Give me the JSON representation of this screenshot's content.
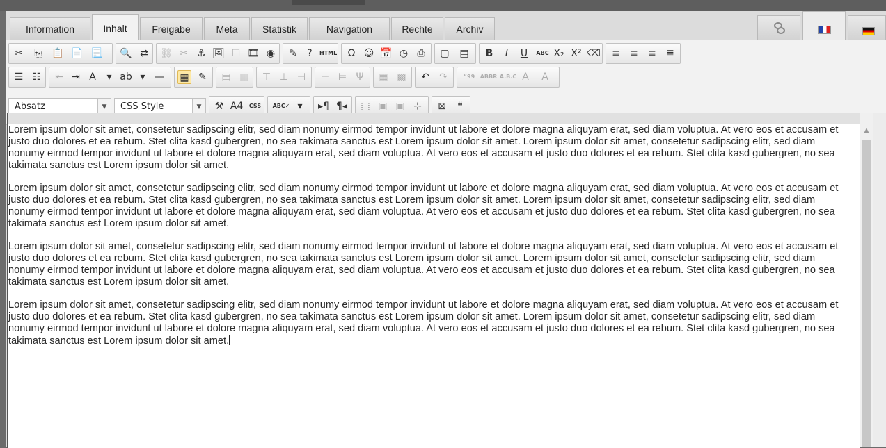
{
  "tabs": [
    {
      "label": "Information",
      "active": false
    },
    {
      "label": "Inhalt",
      "active": true
    },
    {
      "label": "Freigabe",
      "active": false
    },
    {
      "label": "Meta",
      "active": false
    },
    {
      "label": "Statistik",
      "active": false
    },
    {
      "label": "Navigation",
      "active": false
    },
    {
      "label": "Rechte",
      "active": false
    },
    {
      "label": "Archiv",
      "active": false
    }
  ],
  "lang_tabs": [
    {
      "icon": "link-icon"
    },
    {
      "icon": "french-flag-icon",
      "active": true
    },
    {
      "icon": "german-flag-icon"
    }
  ],
  "toolbar": {
    "row1": {
      "clipboard": [
        {
          "name": "cut-icon",
          "glyph": "✂"
        },
        {
          "name": "copy-icon",
          "glyph": "⎘"
        },
        {
          "name": "paste-icon",
          "glyph": "📋"
        },
        {
          "name": "paste-text-icon",
          "glyph": "📄"
        },
        {
          "name": "paste-word-icon",
          "glyph": "📃"
        }
      ],
      "find": [
        {
          "name": "find-icon",
          "glyph": "🔍"
        },
        {
          "name": "replace-icon",
          "glyph": "⇄"
        }
      ],
      "insert": [
        {
          "name": "link-icon",
          "glyph": "⛓",
          "dim": true
        },
        {
          "name": "unlink-icon",
          "glyph": "✂",
          "dim": true
        },
        {
          "name": "anchor-icon",
          "glyph": "⚓"
        },
        {
          "name": "image-icon",
          "glyph": "🖼"
        },
        {
          "name": "media-icon",
          "glyph": "☐",
          "dim": true
        },
        {
          "name": "film-icon",
          "glyph": "🎞"
        },
        {
          "name": "flash-icon",
          "glyph": "◉"
        }
      ],
      "tools": [
        {
          "name": "cleanup-icon",
          "glyph": "✎"
        },
        {
          "name": "help-icon",
          "glyph": "?"
        },
        {
          "name": "html-source-icon",
          "glyph": "HTML"
        }
      ],
      "specials": [
        {
          "name": "special-char-icon",
          "glyph": "Ω"
        },
        {
          "name": "emoticon-icon",
          "glyph": "☺"
        },
        {
          "name": "insert-date-icon",
          "glyph": "📅"
        },
        {
          "name": "insert-time-icon",
          "glyph": "◷"
        },
        {
          "name": "print-icon",
          "glyph": "⎙"
        }
      ],
      "view": [
        {
          "name": "fullscreen-icon",
          "glyph": "▢"
        },
        {
          "name": "preview-icon",
          "glyph": "▤"
        }
      ],
      "format": [
        {
          "name": "bold-icon",
          "glyph": "B"
        },
        {
          "name": "italic-icon",
          "glyph": "I"
        },
        {
          "name": "underline-icon",
          "glyph": "U"
        },
        {
          "name": "strikethrough-icon",
          "glyph": "ABC"
        },
        {
          "name": "subscript-icon",
          "glyph": "X₂"
        },
        {
          "name": "superscript-icon",
          "glyph": "X²"
        },
        {
          "name": "remove-format-icon",
          "glyph": "⌫"
        }
      ],
      "align": [
        {
          "name": "align-left-icon",
          "glyph": "≡"
        },
        {
          "name": "align-center-icon",
          "glyph": "≡"
        },
        {
          "name": "align-right-icon",
          "glyph": "≡"
        },
        {
          "name": "align-justify-icon",
          "glyph": "≣"
        }
      ]
    },
    "row2": {
      "lists": [
        {
          "name": "bullet-list-icon",
          "glyph": "☰"
        },
        {
          "name": "numbered-list-icon",
          "glyph": "☷"
        }
      ],
      "indent": [
        {
          "name": "outdent-icon",
          "glyph": "⇤",
          "dim": true
        },
        {
          "name": "indent-icon",
          "glyph": "⇥"
        },
        {
          "name": "font-color-icon",
          "glyph": "A"
        },
        {
          "name": "font-color-dropdown-icon",
          "glyph": "▾"
        },
        {
          "name": "highlight-icon",
          "glyph": "ab"
        },
        {
          "name": "highlight-dropdown-icon",
          "glyph": "▾"
        },
        {
          "name": "horizontal-rule-icon",
          "glyph": "—"
        }
      ],
      "table": [
        {
          "name": "table-icon",
          "glyph": "▦",
          "sel": true
        },
        {
          "name": "table-edit-icon",
          "glyph": "✎"
        }
      ],
      "table_rows": [
        {
          "name": "row-props-icon",
          "glyph": "▤",
          "dim": true
        },
        {
          "name": "cell-props-icon",
          "glyph": "▥",
          "dim": true
        }
      ],
      "table_insert": [
        {
          "name": "row-before-icon",
          "glyph": "⊤",
          "dim": true
        },
        {
          "name": "row-after-icon",
          "glyph": "⊥",
          "dim": true
        },
        {
          "name": "delete-row-icon",
          "glyph": "⊣",
          "dim": true
        }
      ],
      "table_cols": [
        {
          "name": "col-before-icon",
          "glyph": "⊢",
          "dim": true
        },
        {
          "name": "col-after-icon",
          "glyph": "⊨",
          "dim": true
        },
        {
          "name": "delete-col-icon",
          "glyph": "Ψ",
          "dim": true
        }
      ],
      "table_merge": [
        {
          "name": "split-cells-icon",
          "glyph": "▦",
          "dim": true
        },
        {
          "name": "merge-cells-icon",
          "glyph": "▩",
          "dim": true
        }
      ],
      "history": [
        {
          "name": "undo-icon",
          "glyph": "↶"
        },
        {
          "name": "redo-icon",
          "glyph": "↷",
          "dim": true
        }
      ],
      "text_style": [
        {
          "name": "cite-icon",
          "glyph": "“99",
          "dim": true
        },
        {
          "name": "abbr-icon",
          "glyph": "ABBR",
          "dim": true
        },
        {
          "name": "acronym-icon",
          "glyph": "A.B.C",
          "dim": true
        },
        {
          "name": "del-icon",
          "glyph": "A",
          "dim": true
        },
        {
          "name": "ins-icon",
          "glyph": "A",
          "dim": true
        }
      ]
    },
    "row3": {
      "format_select": "Absatz",
      "style_select": "CSS Style",
      "misc": [
        {
          "name": "attribs-icon",
          "glyph": "⚒"
        },
        {
          "name": "style-props-icon",
          "glyph": "A4"
        },
        {
          "name": "css-icon",
          "glyph": "CSS"
        }
      ],
      "spell": [
        {
          "name": "spellcheck-icon",
          "glyph": "ABC✓"
        },
        {
          "name": "spellcheck-dropdown-icon",
          "glyph": "▾"
        }
      ],
      "direction": [
        {
          "name": "ltr-icon",
          "glyph": "▸¶"
        },
        {
          "name": "rtl-icon",
          "glyph": "¶◂"
        }
      ],
      "layers": [
        {
          "name": "insert-layer-icon",
          "glyph": "⬚"
        },
        {
          "name": "move-forward-icon",
          "glyph": "▣",
          "dim": true
        },
        {
          "name": "move-backward-icon",
          "glyph": "▣",
          "dim": true
        },
        {
          "name": "absolute-pos-icon",
          "glyph": "⊹"
        }
      ],
      "extra": [
        {
          "name": "nonbreaking-icon",
          "glyph": "⊠"
        },
        {
          "name": "blockquote-icon",
          "glyph": "❝"
        }
      ]
    }
  },
  "editor": {
    "paragraphs": [
      "Lorem ipsum dolor sit amet, consetetur sadipscing elitr, sed diam nonumy eirmod tempor invidunt ut labore et dolore magna aliquyam erat, sed diam voluptua. At vero eos et accusam et justo duo dolores et ea rebum. Stet clita kasd gubergren, no sea takimata sanctus est Lorem ipsum dolor sit amet. Lorem ipsum dolor sit amet, consetetur sadipscing elitr, sed diam nonumy eirmod tempor invidunt ut labore et dolore magna aliquyam erat, sed diam voluptua. At vero eos et accusam et justo duo dolores et ea rebum. Stet clita kasd gubergren, no sea takimata sanctus est Lorem ipsum dolor sit amet.",
      "Lorem ipsum dolor sit amet, consetetur sadipscing elitr, sed diam nonumy eirmod tempor invidunt ut labore et dolore magna aliquyam erat, sed diam voluptua. At vero eos et accusam et justo duo dolores et ea rebum. Stet clita kasd gubergren, no sea takimata sanctus est Lorem ipsum dolor sit amet. Lorem ipsum dolor sit amet, consetetur sadipscing elitr, sed diam nonumy eirmod tempor invidunt ut labore et dolore magna aliquyam erat, sed diam voluptua. At vero eos et accusam et justo duo dolores et ea rebum. Stet clita kasd gubergren, no sea takimata sanctus est Lorem ipsum dolor sit amet.",
      "Lorem ipsum dolor sit amet, consetetur sadipscing elitr, sed diam nonumy eirmod tempor invidunt ut labore et dolore magna aliquyam erat, sed diam voluptua. At vero eos et accusam et justo duo dolores et ea rebum. Stet clita kasd gubergren, no sea takimata sanctus est Lorem ipsum dolor sit amet. Lorem ipsum dolor sit amet, consetetur sadipscing elitr, sed diam nonumy eirmod tempor invidunt ut labore et dolore magna aliquyam erat, sed diam voluptua. At vero eos et accusam et justo duo dolores et ea rebum. Stet clita kasd gubergren, no sea takimata sanctus est Lorem ipsum dolor sit amet.",
      "Lorem ipsum dolor sit amet, consetetur sadipscing elitr, sed diam nonumy eirmod tempor invidunt ut labore et dolore magna aliquyam erat, sed diam voluptua. At vero eos et accusam et justo duo dolores et ea rebum. Stet clita kasd gubergren, no sea takimata sanctus est Lorem ipsum dolor sit amet. Lorem ipsum dolor sit amet, consetetur sadipscing elitr, sed diam nonumy eirmod tempor invidunt ut labore et dolore magna aliquyam erat, sed diam voluptua. At vero eos et accusam et justo duo dolores et ea rebum. Stet clita kasd gubergren, no sea takimata sanctus est Lorem ipsum dolor sit amet."
    ]
  }
}
